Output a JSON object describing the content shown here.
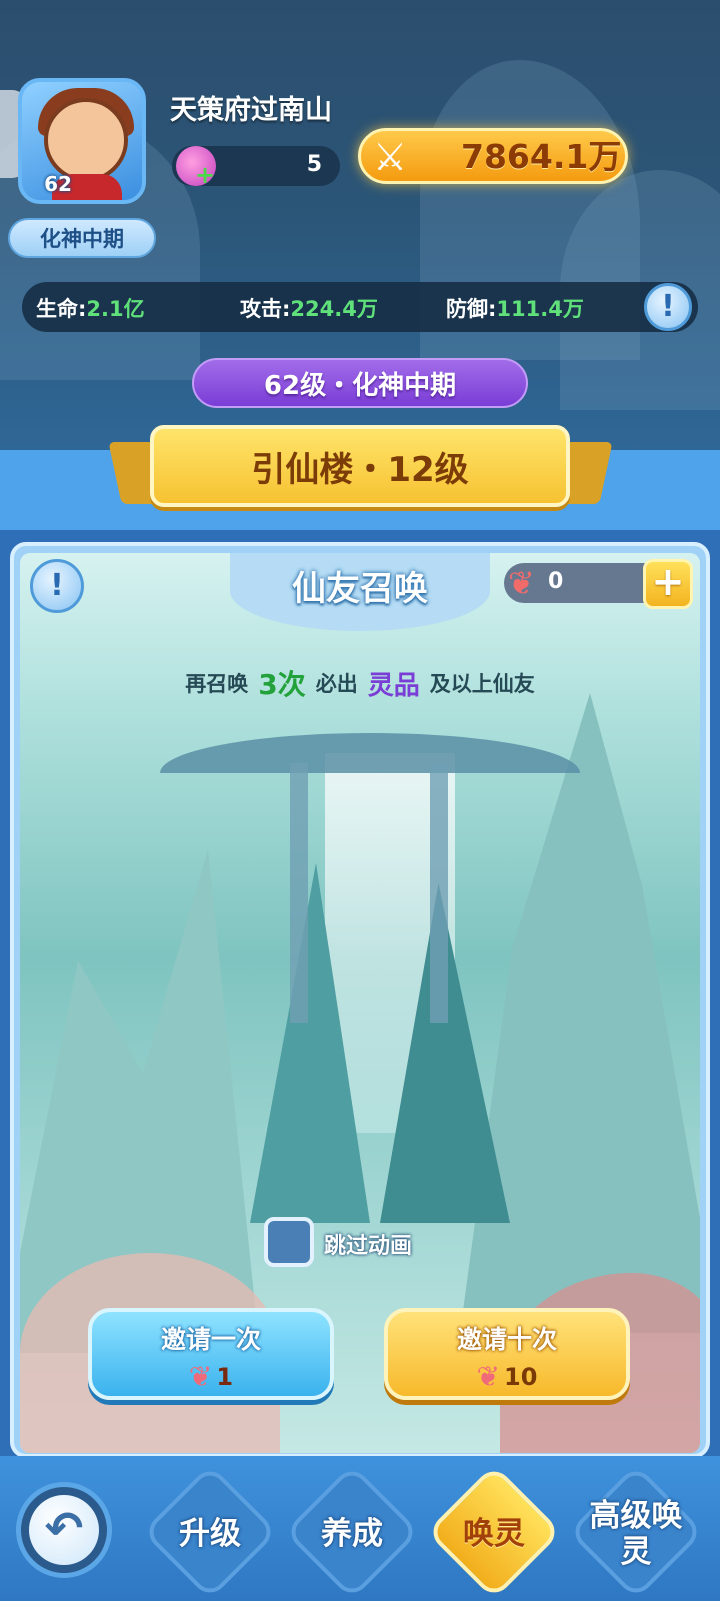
{
  "header": {
    "player_name": "天策府过南山",
    "avatar_level": "62",
    "realm_tag": "化神中期",
    "energy_count": "5",
    "combat_power": "7864.1万",
    "stats": {
      "hp_label": "生命:",
      "hp_value": "2.1亿",
      "atk_label": "攻击:",
      "atk_value": "224.4万",
      "def_label": "防御:",
      "def_value": "111.4万"
    },
    "realm_bar": "62级・化神中期"
  },
  "banner": {
    "title": "引仙楼・12级"
  },
  "summon": {
    "title": "仙友召唤",
    "ticket_count": "0",
    "guarantee": {
      "prefix": "再召唤",
      "times": "3次",
      "middle": "必出",
      "grade": "灵品",
      "suffix": "及以上仙友"
    },
    "skip_animation_label": "跳过动画",
    "invite_once": {
      "label": "邀请一次",
      "cost": "1"
    },
    "invite_ten": {
      "label": "邀请十次",
      "cost": "10"
    }
  },
  "nav": {
    "items": [
      "升级",
      "养成",
      "唤灵",
      "高级唤灵"
    ],
    "active": "唤灵"
  },
  "colors": {
    "power_gold": "#f49b10",
    "stat_value_green": "#5fe07a",
    "realm_purple": "#7a3dd6",
    "grade_purple": "#7a3ed6",
    "times_green": "#23a13a",
    "nav_blue": "#2f77c2"
  },
  "icons": {
    "info": "info-icon",
    "swords": "crossed-swords-icon",
    "energy_orb": "spirit-orb-icon",
    "ticket": "summon-ticket-icon",
    "plus": "plus-icon",
    "back": "back-arrow-icon"
  }
}
